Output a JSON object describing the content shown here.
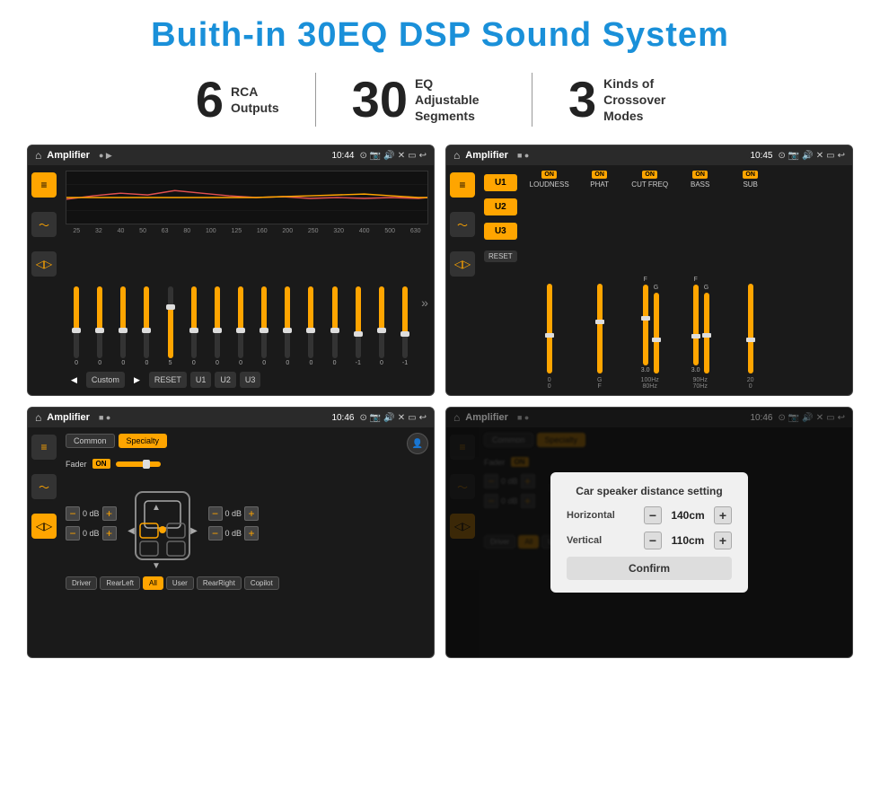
{
  "page": {
    "title": "Buith-in 30EQ DSP Sound System",
    "stats": [
      {
        "number": "6",
        "label": "RCA\nOutputs"
      },
      {
        "number": "30",
        "label": "EQ Adjustable\nSegments"
      },
      {
        "number": "3",
        "label": "Kinds of\nCrossover Modes"
      }
    ],
    "screens": [
      {
        "id": "screen1",
        "statusBar": {
          "title": "Amplifier",
          "time": "10:44"
        },
        "type": "eq"
      },
      {
        "id": "screen2",
        "statusBar": {
          "title": "Amplifier",
          "time": "10:45"
        },
        "type": "crossover"
      },
      {
        "id": "screen3",
        "statusBar": {
          "title": "Amplifier",
          "time": "10:46"
        },
        "type": "speaker-balance"
      },
      {
        "id": "screen4",
        "statusBar": {
          "title": "Amplifier",
          "time": "10:46"
        },
        "type": "distance-dialog"
      }
    ],
    "eq": {
      "frequencies": [
        "25",
        "32",
        "40",
        "50",
        "63",
        "80",
        "100",
        "125",
        "160",
        "200",
        "250",
        "320",
        "400",
        "500",
        "630"
      ],
      "values": [
        "0",
        "0",
        "0",
        "0",
        "5",
        "0",
        "0",
        "0",
        "0",
        "0",
        "0",
        "0",
        "-1",
        "0",
        "-1"
      ],
      "buttons": [
        "◀",
        "Custom",
        "▶",
        "RESET",
        "U1",
        "U2",
        "U3"
      ]
    },
    "crossover": {
      "uButtons": [
        "U1",
        "U2",
        "U3"
      ],
      "channels": [
        {
          "on": true,
          "name": "LOUDNESS"
        },
        {
          "on": true,
          "name": "PHAT"
        },
        {
          "on": true,
          "name": "CUT FREQ"
        },
        {
          "on": true,
          "name": "BASS"
        },
        {
          "on": true,
          "name": "SUB"
        }
      ]
    },
    "speakerBalance": {
      "tabs": [
        "Common",
        "Specialty"
      ],
      "activeTab": "Specialty",
      "faderLabel": "Fader",
      "onLabel": "ON",
      "leftValues": [
        "0 dB",
        "0 dB"
      ],
      "rightValues": [
        "0 dB",
        "0 dB"
      ],
      "bottomButtons": [
        "Driver",
        "RearLeft",
        "All",
        "User",
        "RearRight",
        "Copilot"
      ]
    },
    "distanceDialog": {
      "title": "Car speaker distance setting",
      "horizontal": {
        "label": "Horizontal",
        "value": "140cm"
      },
      "vertical": {
        "label": "Vertical",
        "value": "110cm"
      },
      "confirmLabel": "Confirm"
    }
  }
}
